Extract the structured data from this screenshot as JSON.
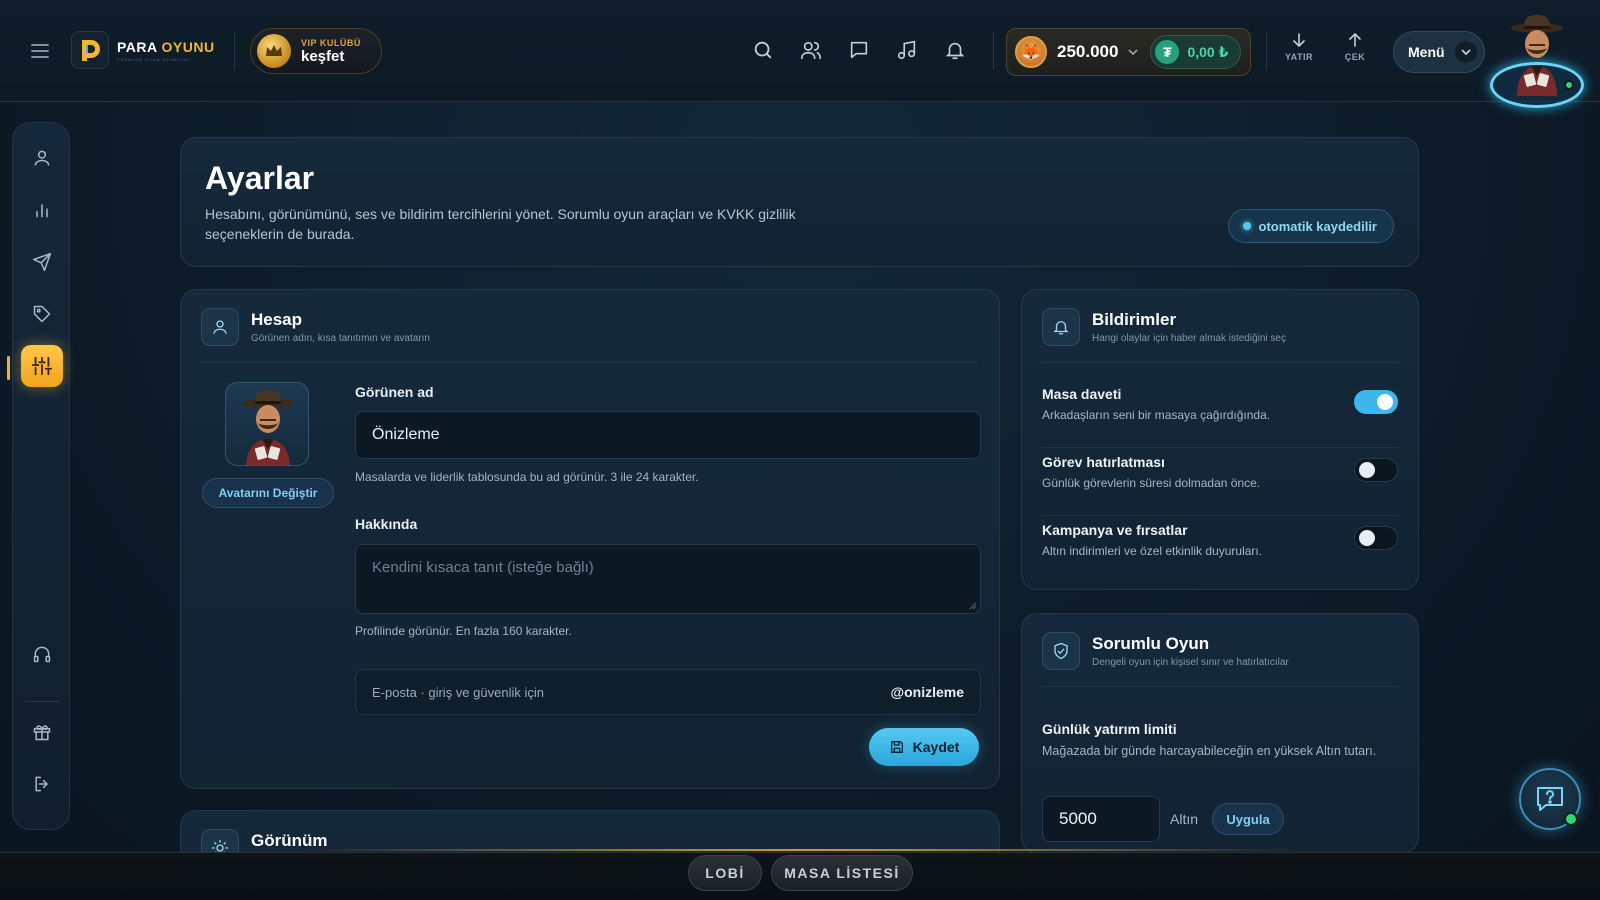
{
  "brand": {
    "name_a": "PARA",
    "name_b": "OYUNU",
    "tagline": "PREMIUM OYUN DENEYİMİ"
  },
  "vip": {
    "small": "VIP KULÜBÜ",
    "big": "keşfet"
  },
  "wallet": {
    "gold": "250.000",
    "usdt": "0,00 ₺"
  },
  "transfer": {
    "deposit": "YATIR",
    "withdraw": "ÇEK"
  },
  "menu": {
    "label": "Menü"
  },
  "hero": {
    "title": "Ayarlar",
    "description": "Hesabını, görünümünü, ses ve bildirim tercihlerini yönet. Sorumlu oyun araçları ve KVKK gizlilik seçeneklerin de burada.",
    "autosave": "otomatik kaydedilir"
  },
  "account": {
    "title": "Hesap",
    "subtitle": "Görünen adın, kısa tanıtımın ve avatarın",
    "change_avatar": "Avatarını Değiştir",
    "display_name_label": "Görünen ad",
    "display_name_value": "Önizleme",
    "display_name_hint": "Masalarda ve liderlik tablosunda bu ad görünür. 3 ile 24 karakter.",
    "about_label": "Hakkında",
    "about_placeholder": "Kendini kısaca tanıt (isteğe bağlı)",
    "about_hint": "Profilinde görünür. En fazla 160 karakter.",
    "email_label": "E-posta · giriş ve güvenlik için",
    "handle": "@onizleme",
    "save": "Kaydet"
  },
  "notifications": {
    "title": "Bildirimler",
    "subtitle": "Hangi olaylar için haber almak istediğini seç",
    "items": [
      {
        "title": "Masa daveti",
        "desc": "Arkadaşların seni bir masaya çağırdığında.",
        "on": true
      },
      {
        "title": "Görev hatırlatması",
        "desc": "Günlük görevlerin süresi dolmadan önce.",
        "on": false
      },
      {
        "title": "Kampanya ve fırsatlar",
        "desc": "Altın indirimleri ve özel etkinlik duyuruları.",
        "on": false
      }
    ]
  },
  "responsible": {
    "title": "Sorumlu Oyun",
    "subtitle": "Dengeli oyun için kişisel sınır ve hatırlatıcılar",
    "limit_label": "Günlük yatırım limiti",
    "limit_desc": "Mağazada bir günde harcayabileceğin en yüksek Altın tutarı.",
    "limit_value": "5000",
    "unit": "Altın",
    "apply": "Uygula"
  },
  "appearance": {
    "title": "Görünüm"
  },
  "bottom": {
    "lobby": "LOBİ",
    "tables": "MASA LİSTESİ"
  },
  "colors": {
    "accent": "#3db7ec",
    "gold": "#f2b632",
    "active_rail": "#f6b02c"
  }
}
